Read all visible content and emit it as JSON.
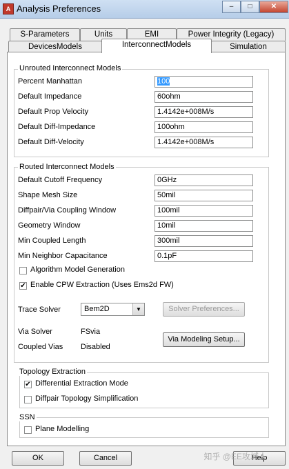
{
  "window": {
    "title": "Analysis Preferences",
    "app_icon": "app-icon",
    "controls": [
      "minimize-icon",
      "maximize-icon",
      "close-icon"
    ]
  },
  "tabs": {
    "row1": [
      "S-Parameters",
      "Units",
      "EMI",
      "Power Integrity (Legacy)"
    ],
    "row2": [
      "DevicesModels",
      "InterconnectModels",
      "Simulation"
    ],
    "active": "InterconnectModels"
  },
  "unrouted": {
    "title": "Unrouted Interconnect Models",
    "fields": [
      {
        "label": "Percent Manhattan",
        "value": "100"
      },
      {
        "label": "Default Impedance",
        "value": "60ohm"
      },
      {
        "label": "Default Prop Velocity",
        "value": "1.4142e+008M/s"
      },
      {
        "label": "Default Diff-Impedance",
        "value": "100ohm"
      },
      {
        "label": "Default Diff-Velocity",
        "value": "1.4142e+008M/s"
      }
    ]
  },
  "routed": {
    "title": "Routed Interconnect Models",
    "fields": [
      {
        "label": "Default Cutoff Frequency",
        "value": "0GHz"
      },
      {
        "label": "Shape Mesh Size",
        "value": "50mil"
      },
      {
        "label": "Diffpair/Via Coupling Window",
        "value": "100mil"
      },
      {
        "label": "Geometry Window",
        "value": "10mil"
      },
      {
        "label": "Min Coupled Length",
        "value": "300mil"
      },
      {
        "label": "Min Neighbor Capacitance",
        "value": "0.1pF"
      }
    ],
    "checkboxes": [
      {
        "label": "Algorithm Model Generation",
        "checked": false
      },
      {
        "label": "Enable CPW Extraction (Uses Ems2d FW)",
        "checked": true
      }
    ],
    "trace_solver": {
      "label": "Trace Solver",
      "value": "Bem2D"
    },
    "solver_preferences": "Solver Preferences...",
    "via_solver": {
      "label": "Via Solver",
      "value": "FSvia"
    },
    "coupled_vias": {
      "label": "Coupled Vias",
      "value": "Disabled"
    },
    "via_modeling_setup": "Via Modeling Setup..."
  },
  "topology": {
    "title": "Topology Extraction",
    "checkboxes": [
      {
        "label": "Differential Extraction Mode",
        "checked": true
      },
      {
        "label": "Diffpair Topology Simplification",
        "checked": false
      }
    ]
  },
  "ssn": {
    "title": "SSN",
    "checkboxes": [
      {
        "label": "Plane Modelling",
        "checked": false
      }
    ]
  },
  "buttons": {
    "ok": "OK",
    "cancel": "Cancel",
    "help": "Help"
  },
  "watermark": "知乎 @EE攻城人",
  "check_mark": "✔"
}
